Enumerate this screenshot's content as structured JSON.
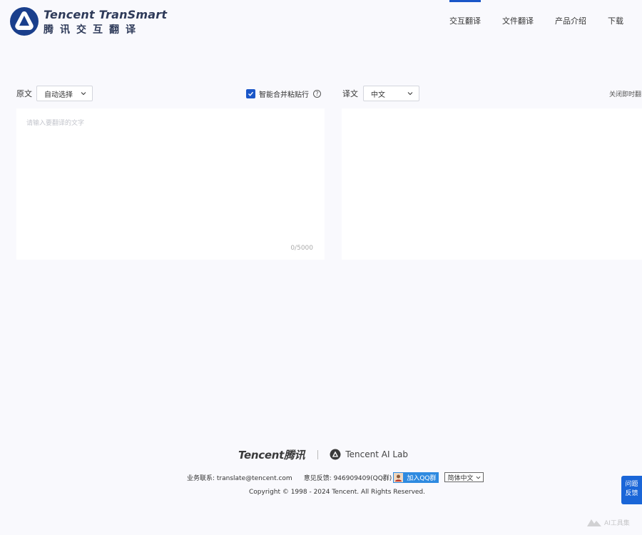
{
  "header": {
    "logo_en": "Tencent TranSmart",
    "logo_cn": "腾讯交互翻译",
    "nav": [
      {
        "label": "交互翻译",
        "active": true
      },
      {
        "label": "文件翻译",
        "active": false
      },
      {
        "label": "产品介绍",
        "active": false
      },
      {
        "label": "下载",
        "active": false
      }
    ]
  },
  "toolbar": {
    "source_label": "原文",
    "source_language": "自动选择",
    "merge_label": "智能合并粘贴行",
    "merge_checked": true,
    "target_label": "译文",
    "target_language": "中文",
    "close_instant": "关闭即时翻"
  },
  "source_panel": {
    "placeholder": "请输入要翻译的文字",
    "value": "",
    "counter": "0/5000"
  },
  "footer": {
    "tencent_logo": "Tencent腾讯",
    "ailab_label": "Tencent AI Lab",
    "contact": "业务联系: translate@tencent.com",
    "feedback": "意见反馈: 946909409(QQ群)",
    "qq_button": "加入QQ群",
    "language": "简体中文",
    "copyright": "Copyright © 1998 - 2024 Tencent. All Rights Reserved."
  },
  "float_feedback": {
    "line1": "问题",
    "line2": "反馈"
  },
  "watermark": "AI工具集",
  "colors": {
    "brand": "#1a56c8",
    "background": "#f9f9fd",
    "panel": "#ffffff",
    "qq_button": "#2e8ae0",
    "float": "#1a66d8"
  }
}
